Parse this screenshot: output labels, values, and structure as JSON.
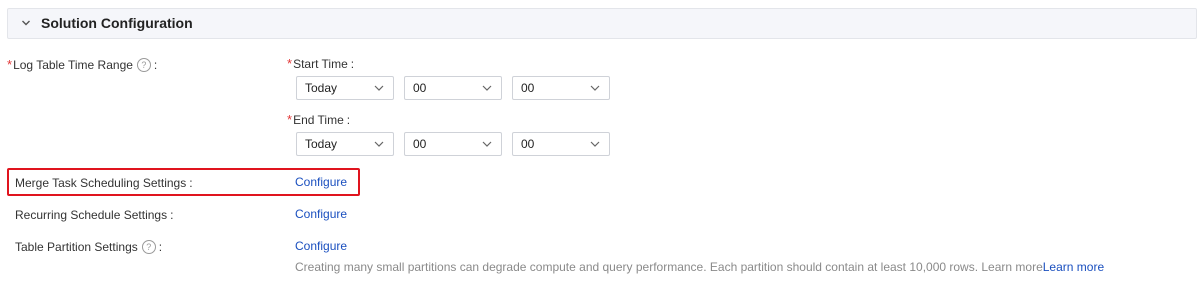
{
  "section": {
    "title": "Solution Configuration"
  },
  "log_table_time_range": {
    "label": "Log Table Time Range",
    "required_mark": "*",
    "help_icon": "question-circle-icon",
    "colon": ":"
  },
  "start_time": {
    "label": "Start Time",
    "required_mark": "*",
    "colon": ":",
    "day_value": "Today",
    "hour_value": "00",
    "minute_value": "00"
  },
  "end_time": {
    "label": "End Time",
    "required_mark": "*",
    "colon": ":",
    "day_value": "Today",
    "hour_value": "00",
    "minute_value": "00"
  },
  "merge_task": {
    "label": "Merge Task Scheduling Settings",
    "colon": ":",
    "link": "Configure"
  },
  "recurring_schedule": {
    "label": "Recurring Schedule Settings",
    "colon": ":",
    "link": "Configure"
  },
  "table_partition": {
    "label": "Table Partition Settings",
    "help_icon": "question-circle-icon",
    "colon": ":",
    "link": "Configure",
    "hint_text": "Creating many small partitions can degrade compute and query performance. Each partition should contain at least 10,000 rows. Learn more",
    "hint_link": "Learn more"
  },
  "colors": {
    "link": "#1a4fbf",
    "required": "#e23636",
    "highlight": "#e0141e"
  }
}
